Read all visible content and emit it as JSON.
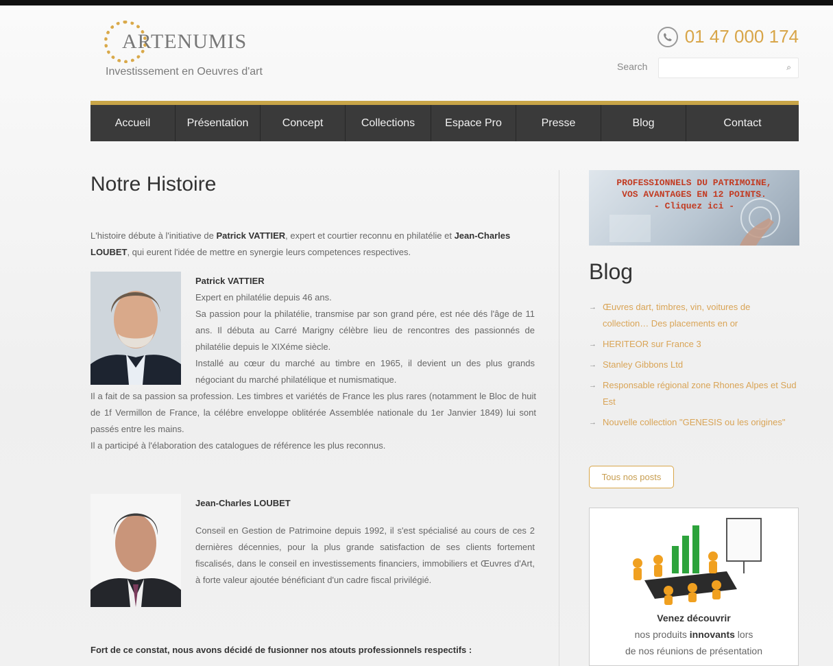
{
  "header": {
    "logo_text": "ARTENUMIS",
    "tagline": "Investissement en Oeuvres d'art",
    "phone": "01 47 000 174",
    "search_label": "Search",
    "search_value": ""
  },
  "nav": {
    "items": [
      {
        "label": "Accueil"
      },
      {
        "label": "Présentation"
      },
      {
        "label": "Concept"
      },
      {
        "label": "Collections"
      },
      {
        "label": "Espace Pro"
      },
      {
        "label": "Presse"
      },
      {
        "label": "Blog"
      },
      {
        "label": "Contact"
      }
    ]
  },
  "main": {
    "title": "Notre Histoire",
    "intro": {
      "part1": "L'histoire débute à l'initiative de ",
      "name1": "Patrick VATTIER",
      "part2": ", expert et courtier reconnu en philatélie et ",
      "name2": "Jean-Charles LOUBET",
      "part3": ", qui eurent l'idée de mettre en synergie leurs competences respectives."
    },
    "bio1": {
      "name": "Patrick VATTIER",
      "lines": [
        "Expert en philatélie depuis 46 ans.",
        "Sa passion pour la philatélie, transmise par son grand pére, est née dés l'âge de 11 ans. Il débuta au Carré Marigny célèbre lieu de rencontres des passionnés de philatélie depuis le XIXéme siècle.",
        "Installé au cœur du marché au timbre en 1965, il devient un des plus grands négociant du marché philatélique et numismatique."
      ],
      "continued": [
        "Il a fait de sa passion sa profession. Les timbres et variétés de France les plus rares (notamment le Bloc de huit de 1f Vermillon de France, la célébre enveloppe oblitérée Assemblée nationale du  1er Janvier 1849) lui sont passés entre les mains.",
        "Il a participé à l'élaboration des catalogues de référence les plus reconnus."
      ]
    },
    "bio2": {
      "name": "Jean-Charles LOUBET",
      "text": "Conseil en Gestion de Patrimoine depuis 1992, il s'est spécialisé au cours de ces 2 dernières décennies, pour la plus grande satisfaction de ses clients fortement fiscalisés, dans le conseil en investissements financiers, immobiliers et Œuvres d'Art, à forte valeur ajoutée bénéficiant d'un cadre fiscal privilégié."
    },
    "closing": "Fort de ce constat, nous avons décidé de fusionner nos atouts professionnels respectifs :"
  },
  "sidebar": {
    "banner_lines": [
      "PROFESSIONNELS DU PATRIMOINE,",
      "VOS AVANTAGES EN 12 POINTS.",
      "- Cliquez ici -"
    ],
    "blog_title": "Blog",
    "blog_posts": [
      "Œuvres dart, timbres, vin, voitures de collection… Des placements en or",
      "HERITEOR sur France 3",
      "Stanley Gibbons Ltd",
      "Responsable régional zone Rhones Alpes et Sud Est",
      "Nouvelle collection \"GENESIS ou les origines\""
    ],
    "all_posts_label": "Tous nos posts",
    "promo": {
      "line1": "Venez découvrir",
      "line2a": "nos produits ",
      "line2b": "innovants",
      "line2c": " lors",
      "line3": "de nos réunions de présentation"
    }
  },
  "colors": {
    "accent": "#d8a548",
    "nav_bg": "#3a3a3a",
    "banner_text": "#c23b22"
  }
}
